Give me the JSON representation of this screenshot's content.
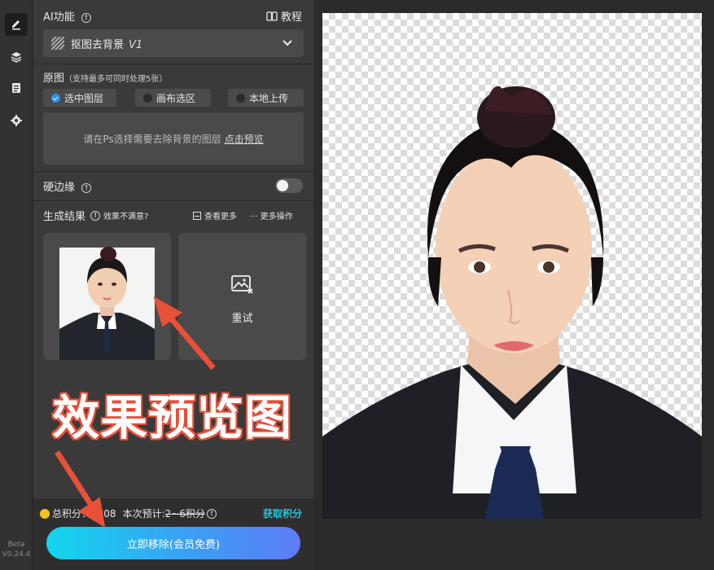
{
  "rail": {
    "items": [
      "pen-icon",
      "layers-icon",
      "clipboard-icon",
      "gear-icon"
    ],
    "beta": "Beta",
    "version": "V0.24.4"
  },
  "ai": {
    "title": "AI功能",
    "tutorial": "教程",
    "feature": "抠图去背景",
    "feature_version": "V1"
  },
  "source": {
    "title": "原图",
    "hint": "（支持最多可同时处理5张）",
    "options": [
      "选中图层",
      "画布选区",
      "本地上传"
    ],
    "selected": "选中图层",
    "box_text": "请在Ps选择需要去除背景的图层",
    "box_link": "点击预览"
  },
  "hard_edge": {
    "label": "硬边缘",
    "enabled": false
  },
  "results": {
    "title": "生成结果",
    "unsatisfied": "效果不满意?",
    "view_more": "查看更多",
    "more_ops": "更多操作",
    "retry": "重试"
  },
  "footer": {
    "points_label": "总积分：",
    "points_value": "3808",
    "estimate_label": "本次预计:",
    "estimate_value": "2~6积分",
    "get_points": "获取积分",
    "primary_button": "立即移除(会员免费)"
  },
  "annotation": {
    "text": "效果预览图"
  },
  "colors": {
    "accent_cyan": "#12d6ec",
    "accent_blue": "#5f7cf6",
    "link_cyan": "#1ec8e6",
    "annotation_red": "#e8503a",
    "coin": "#f2c21b"
  }
}
